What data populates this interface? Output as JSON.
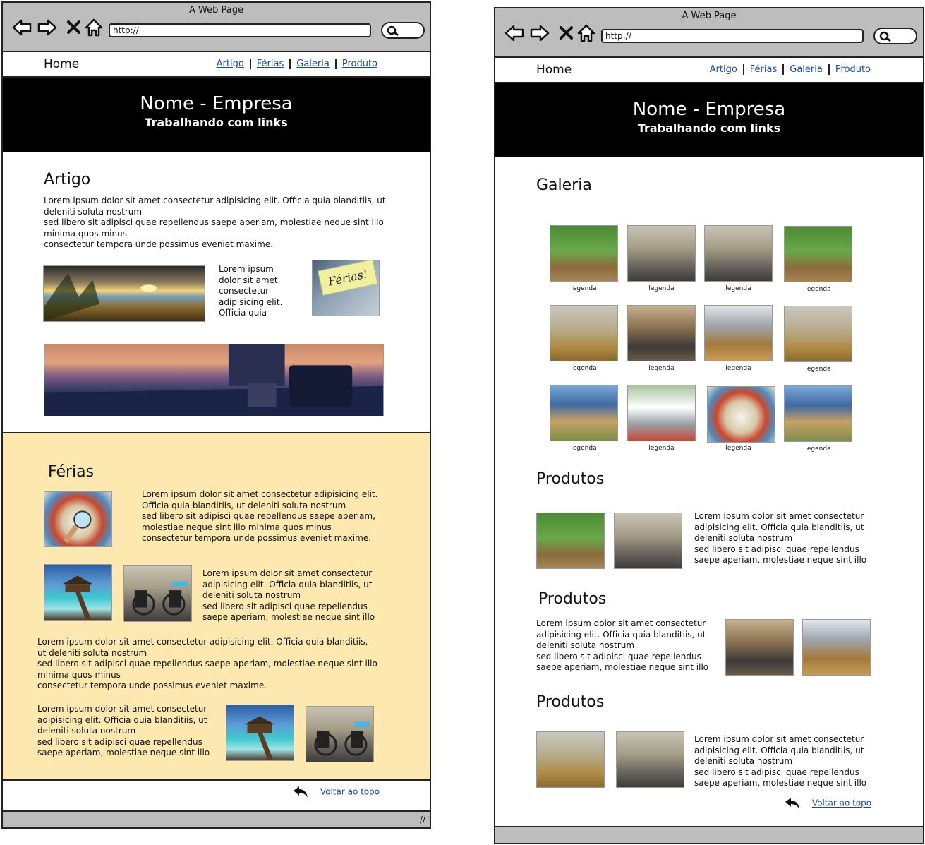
{
  "browser": {
    "window_title": "A Web Page",
    "url": "http://"
  },
  "site": {
    "home_label": "Home",
    "nav_links": [
      "Artigo",
      "Férias",
      "Galeria",
      "Produto"
    ],
    "title": "Nome - Empresa",
    "subtitle": "Trabalhando com links",
    "back_to_top": "Voltar ao topo"
  },
  "page1": {
    "artigo": {
      "title": "Artigo",
      "text": " Lorem ipsum dolor sit amet consectetur adipisicing elit. Officia quia blanditiis, ut deleniti soluta nostrum\nsed libero sit adipisci quae repellendus saepe aperiam, molestiae neque sint illo minima quos minus\nconsectetur tempora unde possimus eveniet maxime.",
      "side_text": "Lorem ipsum\ndolor sit amet\nconsectetur\nadipisicing elit.\nOfficia quia",
      "note_text": "Férias!"
    },
    "ferias": {
      "title": "Férias",
      "block1": " Lorem ipsum dolor sit amet consectetur adipisicing elit.\nOfficia quia blanditiis, ut deleniti soluta nostrum\nsed libero sit adipisci quae repellendus saepe aperiam,\nmolestiae neque sint illo minima quos minus\nconsectetur tempora unde possimus eveniet maxime.",
      "block2": " Lorem ipsum dolor sit amet consectetur\nadipisicing elit. Officia quia blanditiis, ut\ndeleniti soluta nostrum\nsed libero sit adipisci quae repellendus\nsaepe aperiam, molestiae neque sint illo",
      "block3": " Lorem ipsum dolor sit amet consectetur adipisicing elit. Officia quia blanditiis,\nut deleniti soluta nostrum\nsed libero sit adipisci quae repellendus saepe aperiam, molestiae neque sint illo\nminima quos minus\nconsectetur tempora unde possimus eveniet maxime.",
      "block4": " Lorem ipsum dolor sit amet consectetur\nadipisicing elit. Officia quia blanditiis, ut\ndeleniti soluta nostrum\nsed libero sit adipisci quae repellendus\nsaepe aperiam, molestiae neque sint illo"
    }
  },
  "page2": {
    "galeria": {
      "title": "Galeria",
      "caption": "legenda"
    },
    "produtos": [
      {
        "title": "Produtos",
        "text": " Lorem ipsum dolor sit amet consectetur\nadipisicing elit. Officia quia blanditiis, ut\ndeleniti soluta nostrum\nsed libero sit adipisci quae repellendus\nsaepe aperiam, molestiae neque sint illo"
      },
      {
        "title": "Produtos",
        "text": " Lorem ipsum dolor sit amet consectetur\nadipisicing elit. Officia quia blanditiis, ut\ndeleniti soluta nostrum\nsed libero sit adipisci quae repellendus\nsaepe aperiam, molestiae neque sint illo"
      },
      {
        "title": "Produtos",
        "text": " Lorem ipsum dolor sit amet consectetur\nadipisicing elit. Officia quia blanditiis, ut\ndeleniti soluta nostrum\nsed libero sit adipisci quae repellendus\nsaepe aperiam, molestiae neque sint illo"
      }
    ]
  },
  "colors": {
    "chrome": "#bdbdbd",
    "hero": "#000000",
    "ferias_bg": "#fde9b0",
    "link": "#1a4a9c"
  }
}
